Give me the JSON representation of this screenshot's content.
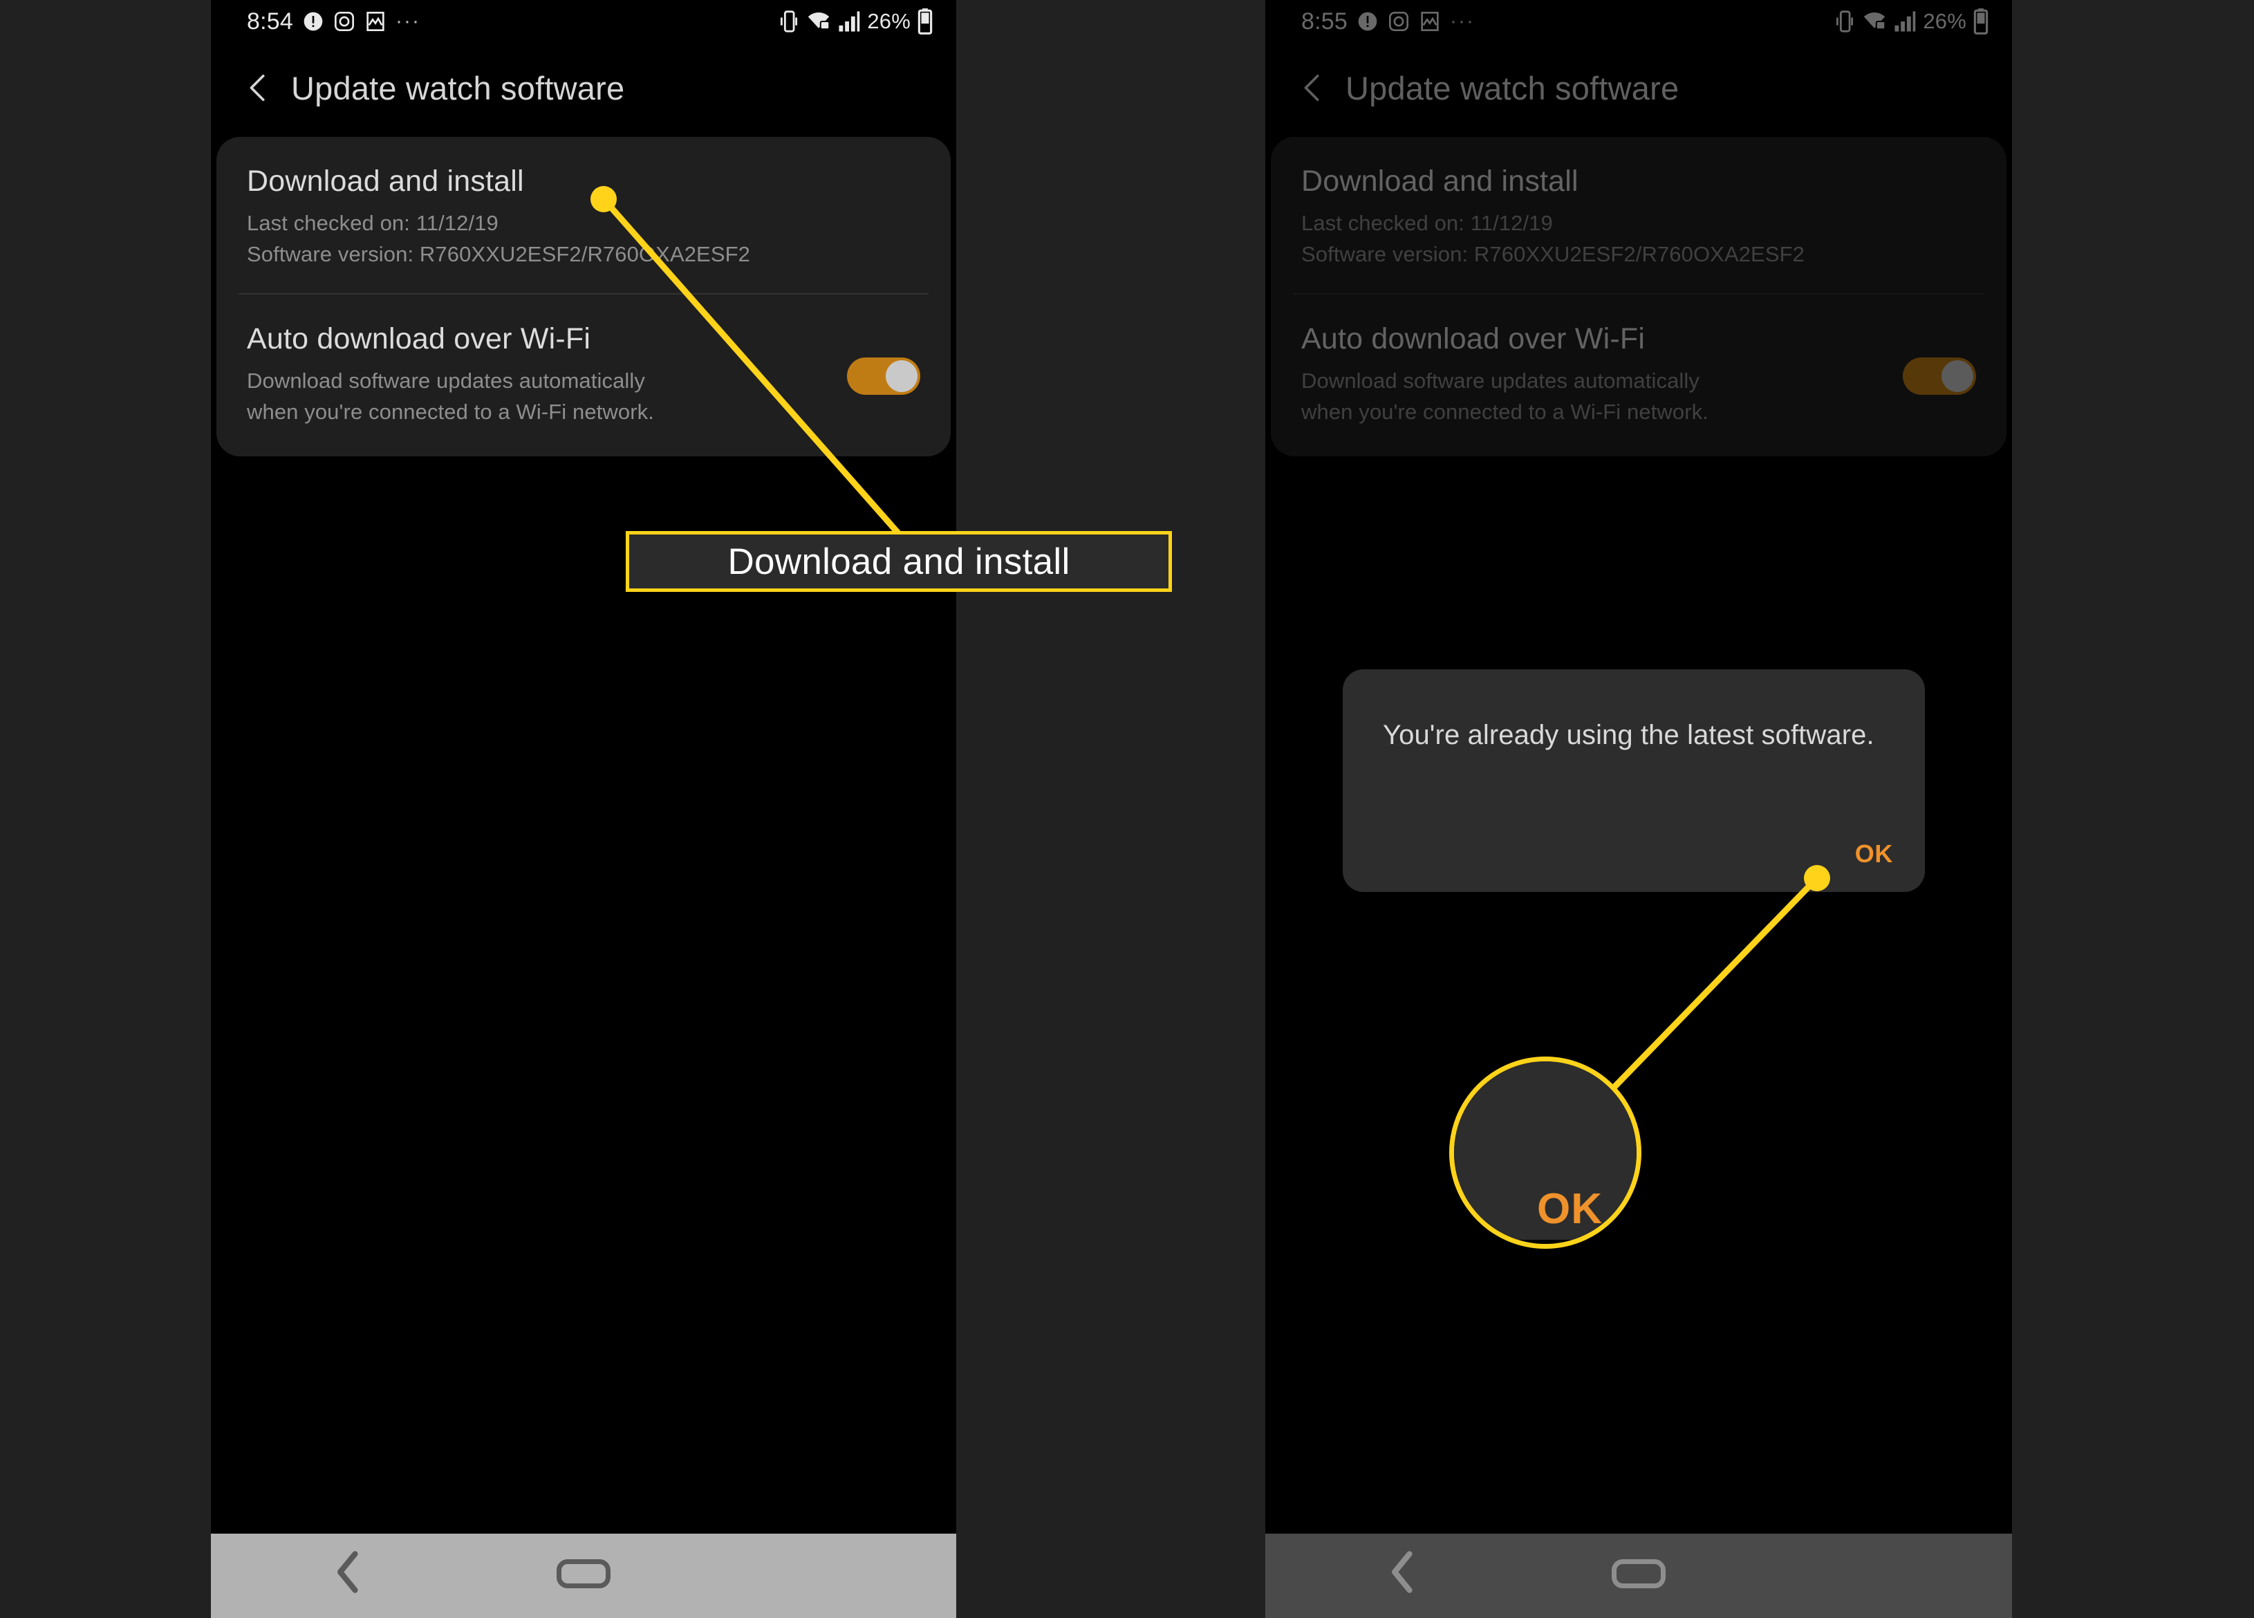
{
  "meta": {
    "background_color": "#212121",
    "accent_yellow": "#ffd31a",
    "accent_orange": "#f0922b",
    "toggle_on_color": "#c07c14"
  },
  "left_phone": {
    "status_bar": {
      "time": "8:54",
      "battery_percent": "26%",
      "overflow": "···",
      "icons": [
        "warning-circle-icon",
        "camera-icon",
        "image-icon",
        "vibrate-icon",
        "wifi-secure-icon",
        "signal-bars-icon",
        "battery-icon"
      ]
    },
    "title": "Update watch software",
    "rows": [
      {
        "title": "Download and install",
        "sub1": "Last checked on: 11/12/19",
        "sub2": "Software version: R760XXU2ESF2/R760OXA2ESF2"
      },
      {
        "title": "Auto download over Wi-Fi",
        "sub1": "Download software updates automatically",
        "sub2": "when you're connected to a Wi-Fi network.",
        "toggle_state": "on"
      }
    ]
  },
  "right_phone": {
    "status_bar": {
      "time": "8:55",
      "battery_percent": "26%",
      "overflow": "···"
    },
    "title": "Update watch software",
    "rows": [
      {
        "title": "Download and install",
        "sub1": "Last checked on: 11/12/19",
        "sub2": "Software version: R760XXU2ESF2/R760OXA2ESF2"
      },
      {
        "title": "Auto download over Wi-Fi",
        "sub1": "Download software updates automatically",
        "sub2": "when you're connected to a Wi-Fi network.",
        "toggle_state": "on"
      }
    ],
    "dialog": {
      "message": "You're already using the latest software.",
      "ok_label": "OK"
    }
  },
  "annotations": {
    "callout_label": "Download and install",
    "magnifier_label": "OK"
  }
}
